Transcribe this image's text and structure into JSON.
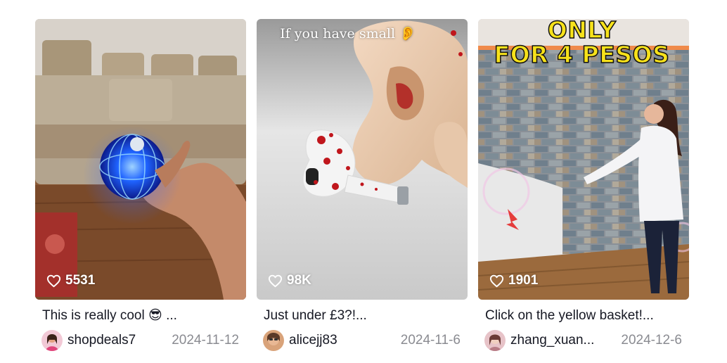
{
  "videos": [
    {
      "likes": "5531",
      "caption": "This is really cool 😎 ...",
      "username": "shopdeals7",
      "date": "2024-11-12",
      "overlay_text": "",
      "overlay_lines": []
    },
    {
      "likes": "98K",
      "caption": "Just under £3?!...",
      "username": "alicejj83",
      "date": "2024-11-6",
      "overlay_text": "If you have small 👂",
      "overlay_lines": []
    },
    {
      "likes": "1901",
      "caption": "Click on the yellow basket!...",
      "username": "zhang_xuan...",
      "date": "2024-12-6",
      "overlay_text": "",
      "overlay_lines": [
        "ONLY",
        "FOR 4 PESOS"
      ]
    }
  ],
  "icons": {
    "likes": "heart-outline-icon"
  },
  "colors": {
    "text": "#161823",
    "muted": "#8a8b91",
    "overlay_yellow": "#f7e21a"
  }
}
